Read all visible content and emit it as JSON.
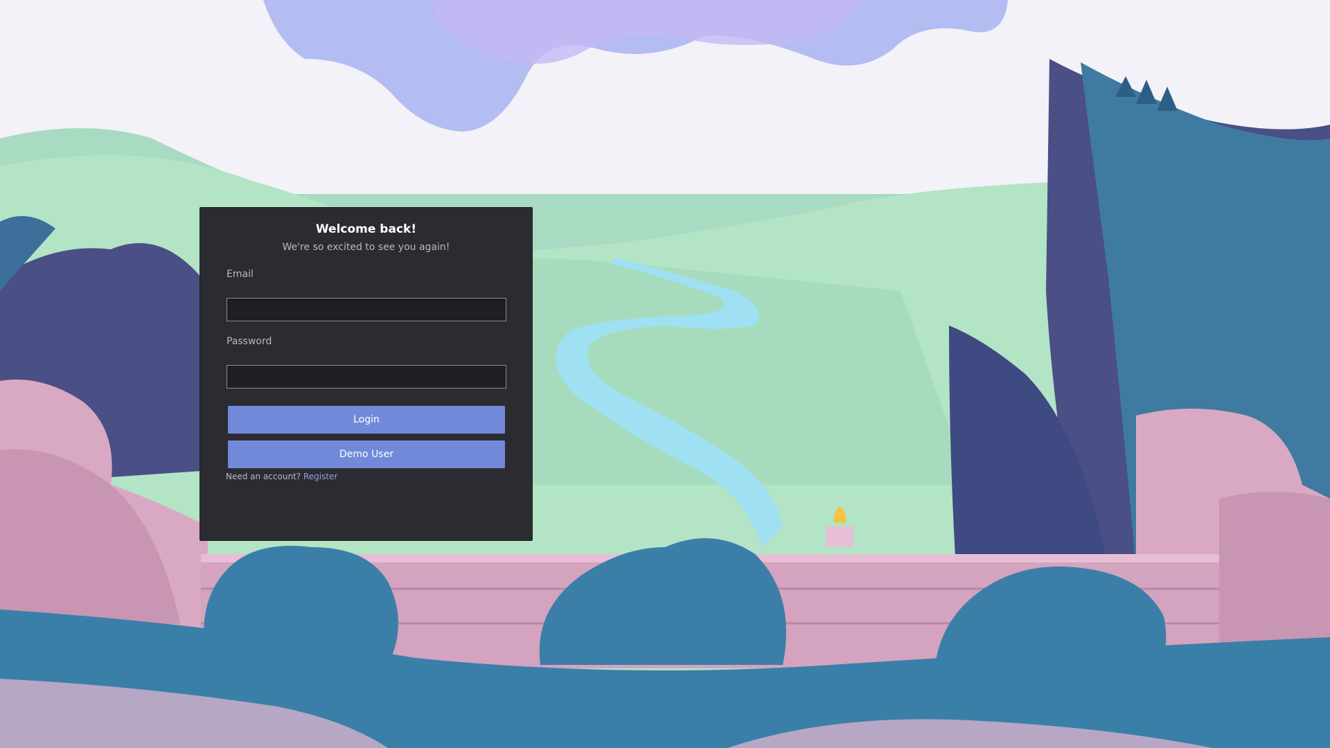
{
  "login": {
    "title": "Welcome back!",
    "subtitle": "We're so excited to see you again!",
    "email_label": "Email",
    "email_value": "",
    "password_label": "Password",
    "password_value": "",
    "login_button": "Login",
    "demo_button": "Demo User",
    "register_prompt": "Need an account?",
    "register_link": "Register"
  },
  "colors": {
    "card_background": "#2b2c31",
    "button": "#7289da",
    "link": "#8ea1e1",
    "sky": "#f3f2f8",
    "meadow": "#b3e4c6",
    "river": "#9fe0f2",
    "cliffs": "#3f7ba0",
    "rocks": "#d9a9c3",
    "ground": "#3a7fa8"
  }
}
